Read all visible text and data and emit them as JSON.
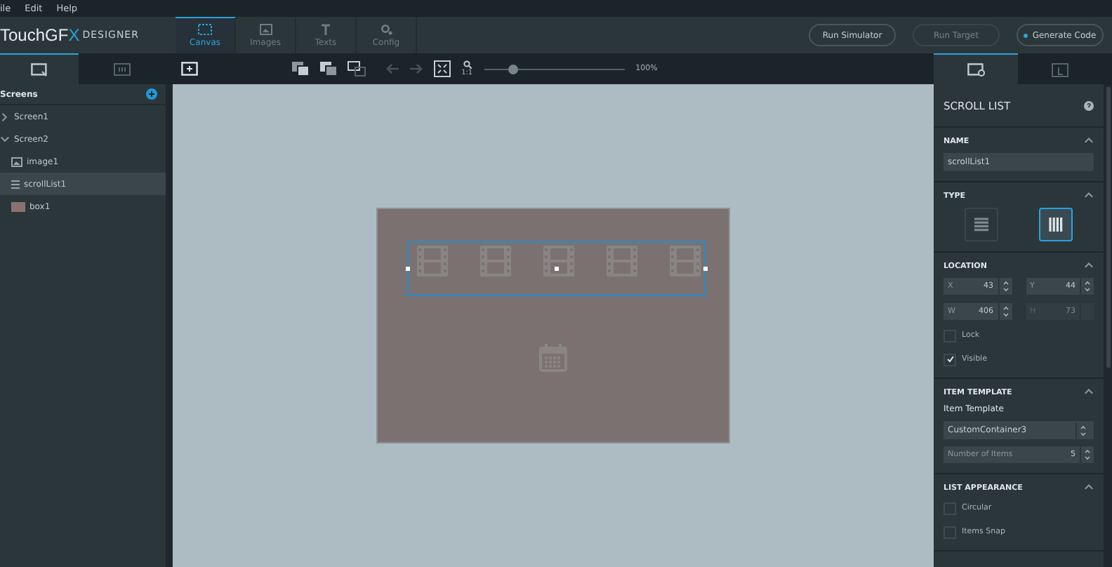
{
  "menu": [
    "ile",
    "Edit",
    "Help"
  ],
  "logo": {
    "brand": "TouchGF",
    "mark": "X",
    "product": "DESIGNER"
  },
  "tabs": [
    {
      "label": "Canvas",
      "selected": true
    },
    {
      "label": "Images",
      "selected": false
    },
    {
      "label": "Texts",
      "selected": false
    },
    {
      "label": "Config",
      "selected": false
    }
  ],
  "buttons": [
    {
      "label": "Run Simulator",
      "kind": "plain",
      "disabled": false
    },
    {
      "label": "Run Target",
      "kind": "plain",
      "disabled": true
    },
    {
      "label": "Generate Code",
      "kind": "primary",
      "disabled": false
    }
  ],
  "left_tabs": [
    {
      "selected": true
    },
    {
      "selected": false
    }
  ],
  "toolbar": {
    "zoom_label": "1:1",
    "zoom": {
      "level": 0.2
    },
    "zoom_reading": "100%"
  },
  "screens": {
    "title": "Screens",
    "tree": [
      {
        "label": "Screen1",
        "expanded": false,
        "selected": false
      },
      {
        "label": "Screen2",
        "expanded": true,
        "selected": false,
        "children": [
          {
            "label": "image1",
            "kind": "image",
            "selected": false
          },
          {
            "label": "scrollList1",
            "kind": "list",
            "selected": true
          },
          {
            "label": "box1",
            "kind": "box",
            "selected": false
          }
        ]
      }
    ]
  },
  "right_tabs": [
    {
      "selected": true
    },
    {
      "selected": false
    }
  ],
  "properties": {
    "title": "SCROLL LIST",
    "sections": [
      {
        "kind": "name",
        "title": "NAME",
        "value": "scrollList1"
      },
      {
        "kind": "type",
        "title": "TYPE",
        "options": [
          {
            "selected": false
          },
          {
            "selected": true
          }
        ]
      },
      {
        "kind": "location",
        "title": "LOCATION",
        "fields": [
          {
            "label": "X",
            "value": "43",
            "disabled": false
          },
          {
            "label": "Y",
            "value": "44",
            "disabled": false
          },
          {
            "label": "W",
            "value": "406",
            "disabled": false
          },
          {
            "label": "H",
            "value": "73",
            "disabled": true
          }
        ],
        "checks": [
          {
            "label": "Lock",
            "checked": false
          },
          {
            "label": "Visible",
            "checked": true
          }
        ]
      },
      {
        "kind": "template",
        "title": "ITEM TEMPLATE",
        "label": "Item Template",
        "select": "CustomContainer3",
        "count": {
          "label": "Number of Items",
          "value": "5"
        }
      },
      {
        "kind": "appearance",
        "title": "LIST APPEARANCE",
        "checks": [
          {
            "label": "Circular",
            "checked": false
          },
          {
            "label": "Items Snap",
            "checked": false
          }
        ]
      }
    ]
  }
}
